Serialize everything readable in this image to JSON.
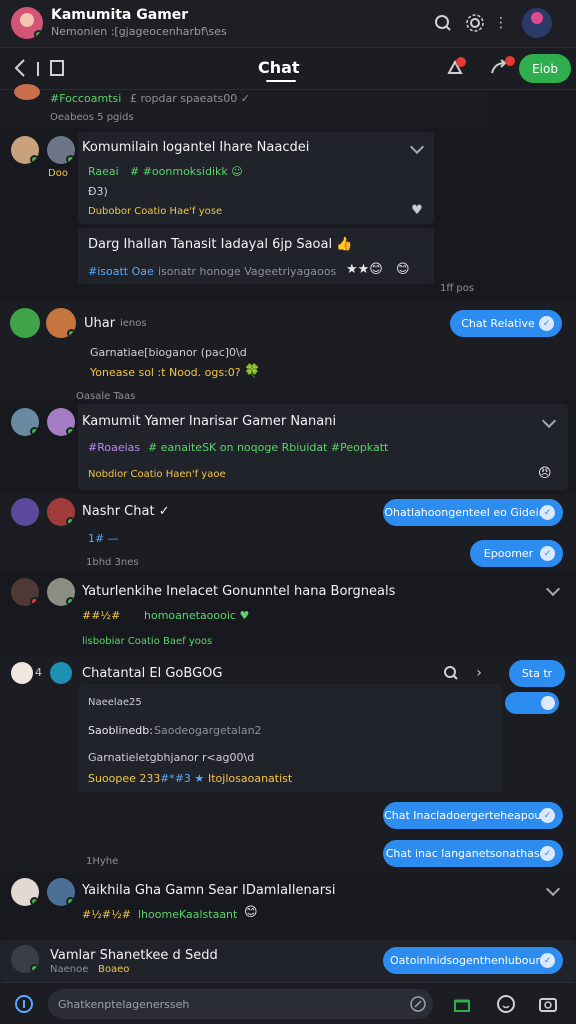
{
  "header": {
    "title": "Kamumita Gamer",
    "subtitle": "Nemonien :[gjageocenharbf\\ses"
  },
  "nav": {
    "tab": "Chat",
    "post_button": "Eiob"
  },
  "messages": [
    {
      "line1": "#Foccoamtsi",
      "line1b": "£ ropdar spaeats00 ✓",
      "meta": "Oeabeos 5 pgids"
    },
    {
      "name": "Komumilain logantel Ihare Naacdei",
      "line1": "Raeai",
      "line1b": "# #oonmoksidikk ☺",
      "line2": "Ð3)",
      "line3": "Dubobor  Coatio  Hae'f yose"
    },
    {
      "name": "Darg Ihallan Tanasit Iadayal 6jp Saoal 👍",
      "line1": "#isoatt  Oae",
      "line1b": "isonatr honoge Vageetriyagaoos",
      "meta": "1ff pos"
    },
    {
      "name": "Uhar",
      "name2": "ienos",
      "bubble": "Chat Relative",
      "line1": "Garnatiae[bioganor (pac]0\\d",
      "line2": "Yonease sol :t Nood. ogs:0?",
      "meta": "Oasale Taas"
    },
    {
      "name": "Kamumit Yamer Inarisar Gamer Nanani",
      "line1": "#Roaeias",
      "line1b": "# eanaiteSK on noqoge Rbiuidat #Peopkatt",
      "line2": "Nobdior  Coatio  Haen'f yaoe"
    },
    {
      "name": "Nashr Chat ✓",
      "bubble1": "Ohatlahoongenteel eo Gidein",
      "line1": "1# —",
      "bubble2": "Epoomer",
      "meta": "1bhd 3nes"
    },
    {
      "name": "Yaturlenkihe Inelacet Gonunntel hana Borgneals",
      "line1": "##½#",
      "line1b": "homoanetaoooic ♥",
      "line2": "lisbobiar  Coatio  Baef yoos"
    },
    {
      "name": "Chatantal El GoBGOG",
      "bubble": "Sta  tr",
      "line1": "Naeelae25",
      "line2": "Saoblinedb:",
      "line2b": "Saodeogargetalan2",
      "line3": "Garnatieletgbhjanor r<ag00\\d",
      "line4": "Suoopee 233",
      "line4b": "#*#3 ★",
      "line4c": "Itojlosaoanatist",
      "bubble2": "Chat Inacladoergerteheapour",
      "bubble3": "Chat inac langanetsonathasr",
      "meta": "1Hyhe"
    },
    {
      "name": "Yaikhila Gha Gamn Sear IDamlaIlenarsi",
      "line1": "#½#½#",
      "line1b": "lhoomeKaalstaant"
    },
    {
      "name": "Vamlar Shanetkee d Sedd",
      "subname": "Naenoe",
      "subname2": "Boaeo",
      "bubble": "Oatoinlnidsogenthenlubour"
    }
  ],
  "composer": {
    "placeholder": "Ghatkenptelagenersseh"
  },
  "colors": {
    "accent_green": "#2fae4e",
    "bubble_blue": "#2d8cf0",
    "background": "#17191e"
  }
}
